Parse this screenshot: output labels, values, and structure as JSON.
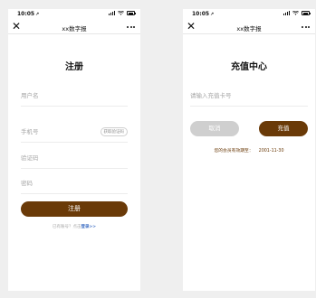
{
  "status_bar": {
    "time": "10:05",
    "location_arrow": "↗"
  },
  "nav": {
    "title": "xx数字报",
    "close_glyph": "✕"
  },
  "register": {
    "title": "注册",
    "username_placeholder": "用户名",
    "phone_placeholder": "手机号",
    "get_code_label": "获取验证码",
    "code_placeholder": "验证码",
    "password_placeholder": "密码",
    "submit_label": "注册",
    "login_hint": "已有账号？点击",
    "login_link": "登录>>"
  },
  "recharge": {
    "title": "充值中心",
    "card_placeholder": "请输入充值卡号",
    "cancel_label": "取消",
    "submit_label": "充值",
    "validity_label": "您的会员有效期至：",
    "validity_date": "2001-11-30"
  },
  "colors": {
    "brand": "#6a3a08",
    "disabled": "#cfcfcf",
    "link": "#3f6fc4",
    "background": "#efefef"
  },
  "icons": [
    "close-icon",
    "more-icon",
    "signal-icon",
    "wifi-icon",
    "battery-icon",
    "location-icon"
  ]
}
